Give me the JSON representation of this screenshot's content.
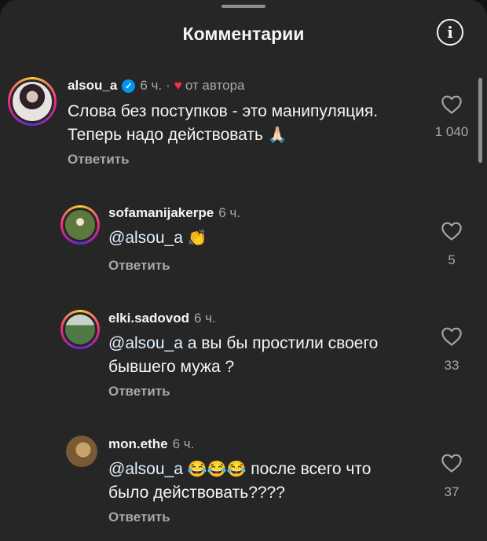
{
  "header": {
    "title": "Комментарии",
    "info_icon": "info-icon"
  },
  "comments": [
    {
      "username": "alsou_a",
      "verified": true,
      "time": "6 ч.",
      "dot": "·",
      "author_badge": "от автора",
      "text_line1": "Слова без поступков - это манипуляция.",
      "text_line2": "Теперь надо действовать",
      "emoji": "🙏🏻",
      "reply_label": "Ответить",
      "likes": "1 040"
    },
    {
      "username": "sofamanijakerpe",
      "time": "6 ч.",
      "mention": "@alsou_a",
      "emoji": "👏",
      "reply_label": "Ответить",
      "likes": "5"
    },
    {
      "username": "elki.sadovod",
      "time": "6 ч.",
      "mention": "@alsou_a",
      "text_line1": "а вы бы простили своего",
      "text_line2": "бывшего мужа ?",
      "reply_label": "Ответить",
      "likes": "33"
    },
    {
      "username": "mon.ethe",
      "time": "6 ч.",
      "mention": "@alsou_a",
      "emoji": "😂😂😂",
      "text_line1": "после всего что",
      "text_line2": "было действовать????",
      "reply_label": "Ответить",
      "likes": "37"
    }
  ]
}
